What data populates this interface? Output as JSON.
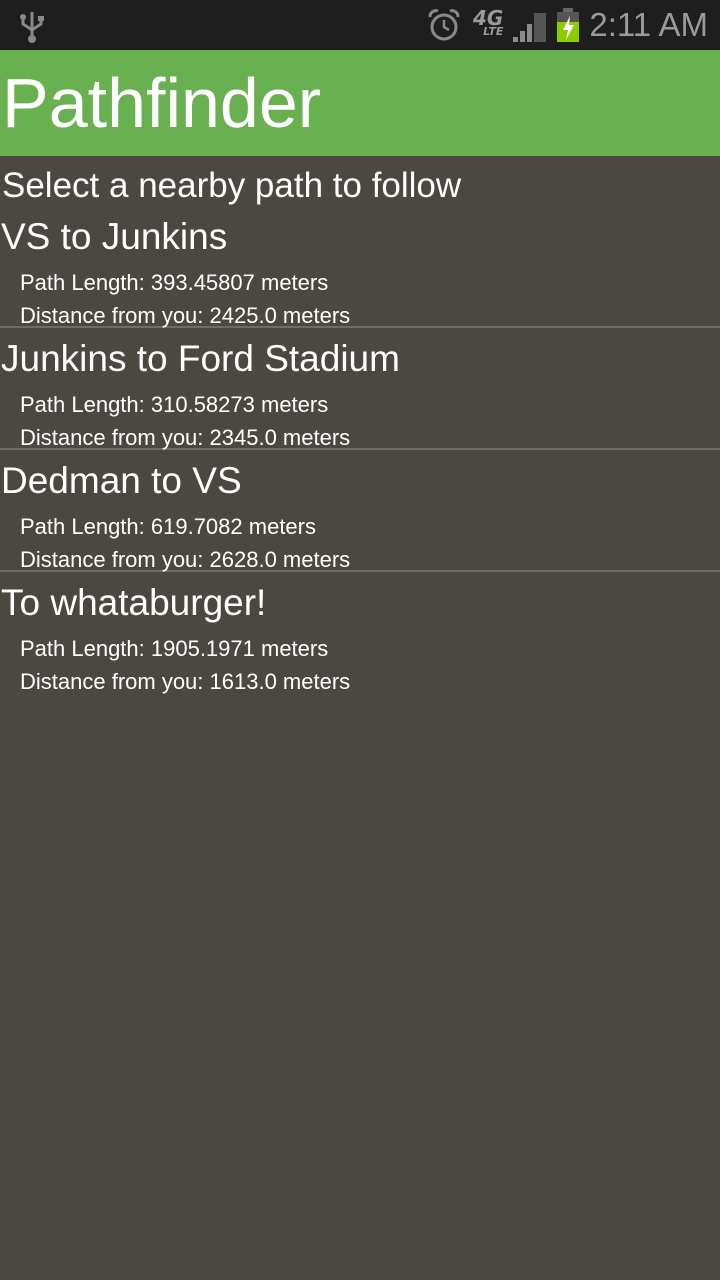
{
  "status_bar": {
    "time": "2:11 AM",
    "network": "4G",
    "network_sub": "LTE",
    "battery_color": "#8ccc00",
    "icons": [
      "usb-icon",
      "alarm-icon",
      "signal-icon",
      "battery-charging-icon"
    ]
  },
  "header": {
    "title": "Pathfinder",
    "color": "#69b150"
  },
  "prompt": "Select a nearby path to follow",
  "paths": [
    {
      "name": "VS to Junkins",
      "length": "Path Length: 393.45807 meters",
      "distance": "Distance from you: 2425.0 meters"
    },
    {
      "name": "Junkins to Ford Stadium",
      "length": "Path Length: 310.58273 meters",
      "distance": "Distance from you: 2345.0 meters"
    },
    {
      "name": "Dedman to VS",
      "length": "Path Length: 619.7082 meters",
      "distance": "Distance from you: 2628.0 meters"
    },
    {
      "name": "To whataburger!",
      "length": "Path Length: 1905.1971 meters",
      "distance": "Distance from you: 1613.0 meters"
    }
  ]
}
